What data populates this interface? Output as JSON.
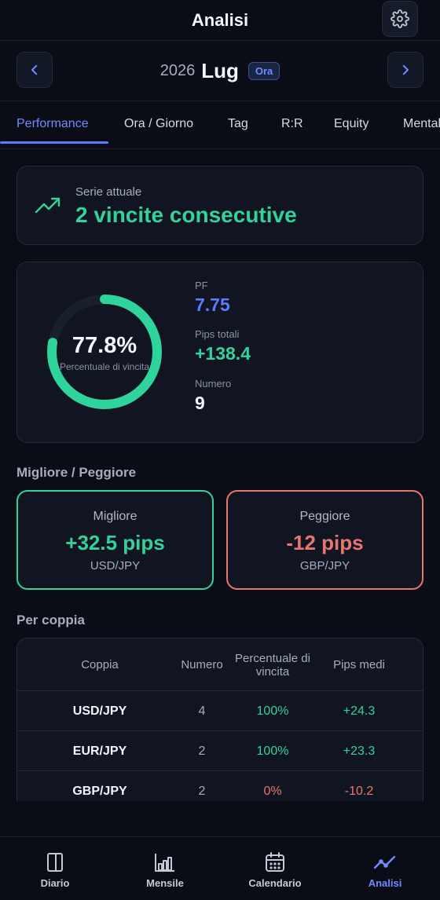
{
  "header": {
    "title": "Analisi"
  },
  "month_nav": {
    "year": "2026",
    "month": "Lug",
    "badge": "Ora"
  },
  "tabs": [
    {
      "label": "Performance"
    },
    {
      "label": "Ora / Giorno"
    },
    {
      "label": "Tag"
    },
    {
      "label": "R:R"
    },
    {
      "label": "Equity"
    },
    {
      "label": "Mentale"
    }
  ],
  "streak": {
    "subtitle": "Serie attuale",
    "value": "2 vincite consecutive"
  },
  "stats": {
    "win_rate_text": "77.8%",
    "win_rate_fraction": 0.778,
    "win_rate_label": "Percentuale di vincita",
    "pf_label": "PF",
    "pf_value": "7.75",
    "pips_label": "Pips totali",
    "pips_value": "+138.4",
    "count_label": "Numero",
    "count_value": "9"
  },
  "best_worst": {
    "title": "Migliore / Peggiore",
    "best": {
      "title": "Migliore",
      "value": "+32.5 pips",
      "pair": "USD/JPY"
    },
    "worst": {
      "title": "Peggiore",
      "value": "-12 pips",
      "pair": "GBP/JPY"
    }
  },
  "by_pair": {
    "title": "Per coppia",
    "headers": {
      "pair": "Coppia",
      "count": "Numero",
      "win_rate": "Percentuale di vincita",
      "avg_pips": "Pips medi"
    },
    "rows": [
      {
        "pair": "USD/JPY",
        "count": "4",
        "win_rate": "100%",
        "avg_pips": "+24.3"
      },
      {
        "pair": "EUR/JPY",
        "count": "2",
        "win_rate": "100%",
        "avg_pips": "+23.3"
      },
      {
        "pair": "GBP/JPY",
        "count": "2",
        "win_rate": "0%",
        "avg_pips": "-10.2"
      }
    ]
  },
  "bottom_nav": [
    {
      "label": "Diario",
      "icon": "journal-icon"
    },
    {
      "label": "Mensile",
      "icon": "bar-chart-icon"
    },
    {
      "label": "Calendario",
      "icon": "calendar-icon"
    },
    {
      "label": "Analisi",
      "icon": "trend-icon"
    }
  ],
  "colors": {
    "accent": "#5b7cff",
    "positive": "#35d19a",
    "negative": "#e8756f"
  }
}
